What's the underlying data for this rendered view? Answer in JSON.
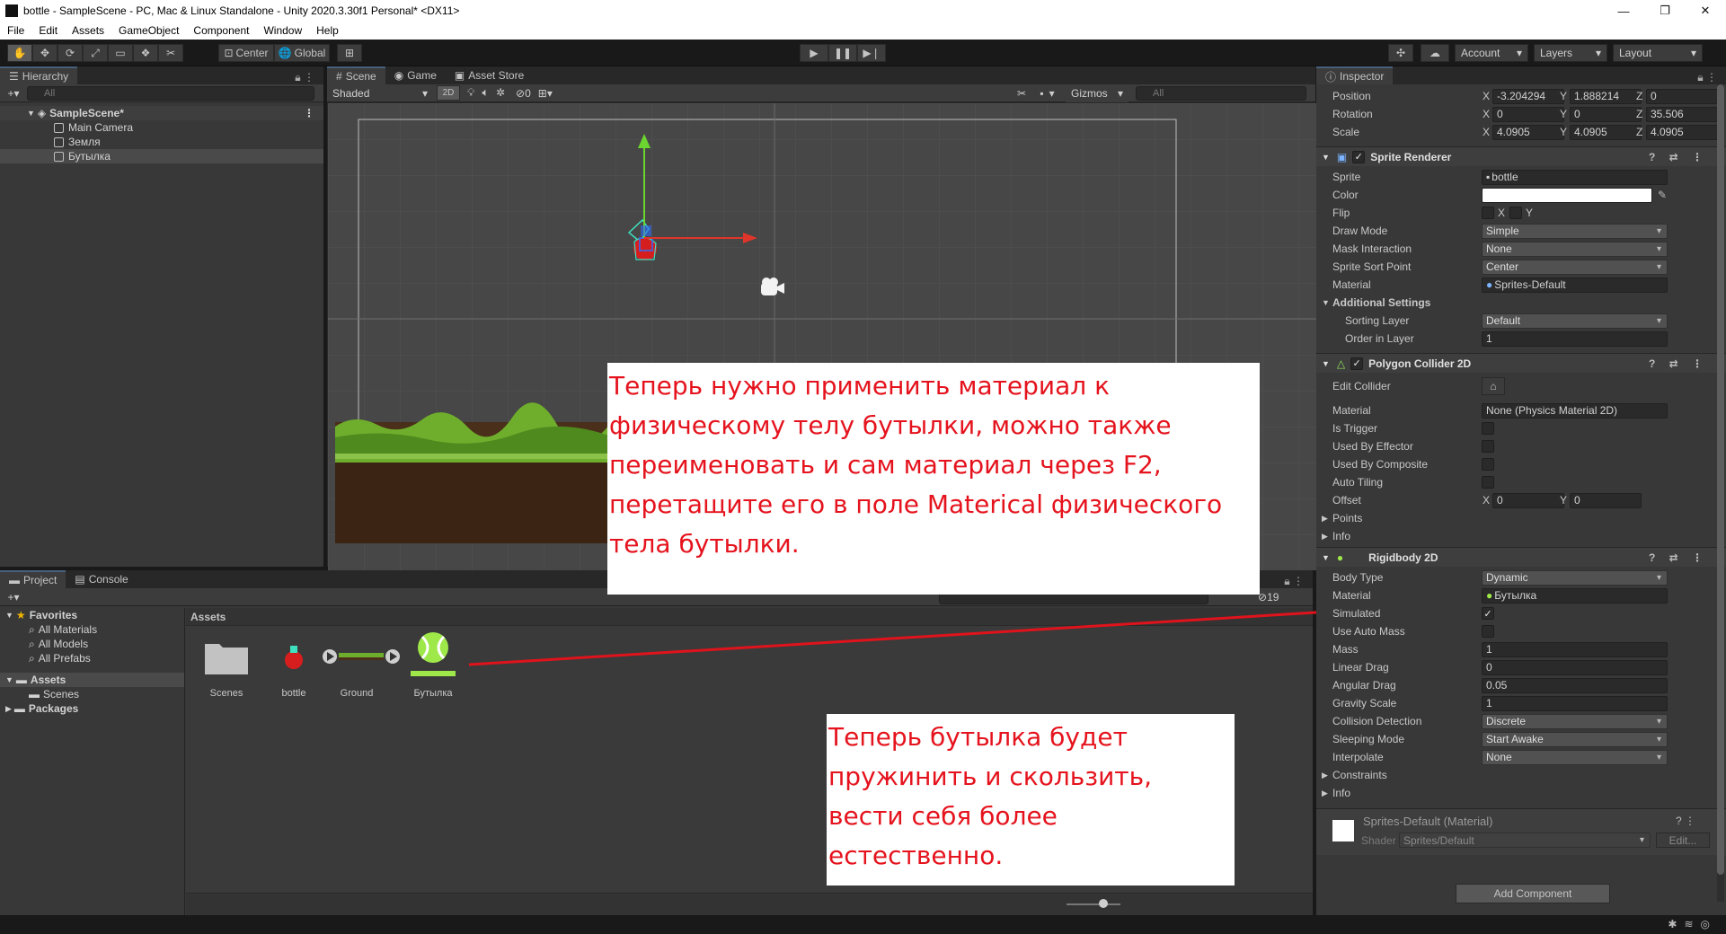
{
  "window": {
    "title": "bottle - SampleScene - PC, Mac & Linux Standalone - Unity 2020.3.30f1 Personal* <DX11>",
    "controls": [
      "—",
      "❐",
      "✕"
    ]
  },
  "menu": [
    "File",
    "Edit",
    "Assets",
    "GameObject",
    "Component",
    "Window",
    "Help"
  ],
  "toolbar": {
    "pivot": "Center",
    "space": "Global",
    "account": "Account",
    "layers": "Layers",
    "layout": "Layout"
  },
  "hierarchy": {
    "tab": "Hierarchy",
    "search_placeholder": "All",
    "scene": "SampleScene*",
    "items": [
      "Main Camera",
      "Земля",
      "Бутылка"
    ]
  },
  "scene_view": {
    "tabs": [
      "Scene",
      "Game",
      "Asset Store"
    ],
    "shading": "Shaded",
    "mode2d": "2D",
    "hidden_count": "0",
    "gizmos": "Gizmos",
    "search_placeholder": "All"
  },
  "notes": {
    "first": "Теперь нужно применить материал к физическому телу бутылки, можно также переименовать и сам материал через F2, перетащите его в поле Materical физического тела бутылки.",
    "second": "Теперь бутылка будет пружинить и скользить, вести себя более естественно."
  },
  "project": {
    "tabs": [
      "Project",
      "Console"
    ],
    "hidden_count": "19",
    "favorites_label": "Favorites",
    "favorites": [
      "All Materials",
      "All Models",
      "All Prefabs"
    ],
    "assets_label": "Assets",
    "assets_children": [
      "Scenes"
    ],
    "packages_label": "Packages",
    "breadcrumb": "Assets",
    "items": [
      "Scenes",
      "bottle",
      "Ground",
      "Бутылка"
    ]
  },
  "inspector": {
    "tab": "Inspector",
    "transform": {
      "position_label": "Position",
      "rotation_label": "Rotation",
      "scale_label": "Scale",
      "position": {
        "x": "-3.204294",
        "y": "1.888214",
        "z": "0"
      },
      "rotation": {
        "x": "0",
        "y": "0",
        "z": "35.506"
      },
      "scale": {
        "x": "4.0905",
        "y": "4.0905",
        "z": "4.0905"
      }
    },
    "sprite_renderer": {
      "title": "Sprite Renderer",
      "sprite_label": "Sprite",
      "sprite": "bottle",
      "color_label": "Color",
      "flip_label": "Flip",
      "flip_x": "X",
      "flip_y": "Y",
      "draw_mode_label": "Draw Mode",
      "draw_mode": "Simple",
      "mask_label": "Mask Interaction",
      "mask": "None",
      "sort_point_label": "Sprite Sort Point",
      "sort_point": "Center",
      "material_label": "Material",
      "material": "Sprites-Default",
      "additional_label": "Additional Settings",
      "sorting_layer_label": "Sorting Layer",
      "sorting_layer": "Default",
      "order_label": "Order in Layer",
      "order": "1"
    },
    "polygon_collider": {
      "title": "Polygon Collider 2D",
      "edit_collider_label": "Edit Collider",
      "material_label": "Material",
      "material": "None (Physics Material 2D)",
      "is_trigger_label": "Is Trigger",
      "effector_label": "Used By Effector",
      "composite_label": "Used By Composite",
      "auto_tiling_label": "Auto Tiling",
      "offset_label": "Offset",
      "offset_x": "0",
      "offset_y": "0",
      "points_label": "Points",
      "info_label": "Info"
    },
    "rigidbody": {
      "title": "Rigidbody 2D",
      "body_type_label": "Body Type",
      "body_type": "Dynamic",
      "material_label": "Material",
      "material": "Бутылка",
      "simulated_label": "Simulated",
      "auto_mass_label": "Use Auto Mass",
      "mass_label": "Mass",
      "mass": "1",
      "linear_drag_label": "Linear Drag",
      "linear_drag": "0",
      "angular_drag_label": "Angular Drag",
      "angular_drag": "0.05",
      "gravity_label": "Gravity Scale",
      "gravity": "1",
      "collision_label": "Collision Detection",
      "collision": "Discrete",
      "sleeping_label": "Sleeping Mode",
      "sleeping": "Start Awake",
      "interpolate_label": "Interpolate",
      "interpolate": "None",
      "constraints_label": "Constraints",
      "info_label": "Info"
    },
    "material_block": {
      "title": "Sprites-Default (Material)",
      "shader_label": "Shader",
      "shader": "Sprites/Default",
      "edit": "Edit..."
    },
    "add_component": "Add Component"
  },
  "colors": {
    "annotation_text": "#e5131d",
    "arrow": "#e0131c",
    "tab_accent": "#46607c",
    "physics_material_green": "#9ee84a"
  }
}
